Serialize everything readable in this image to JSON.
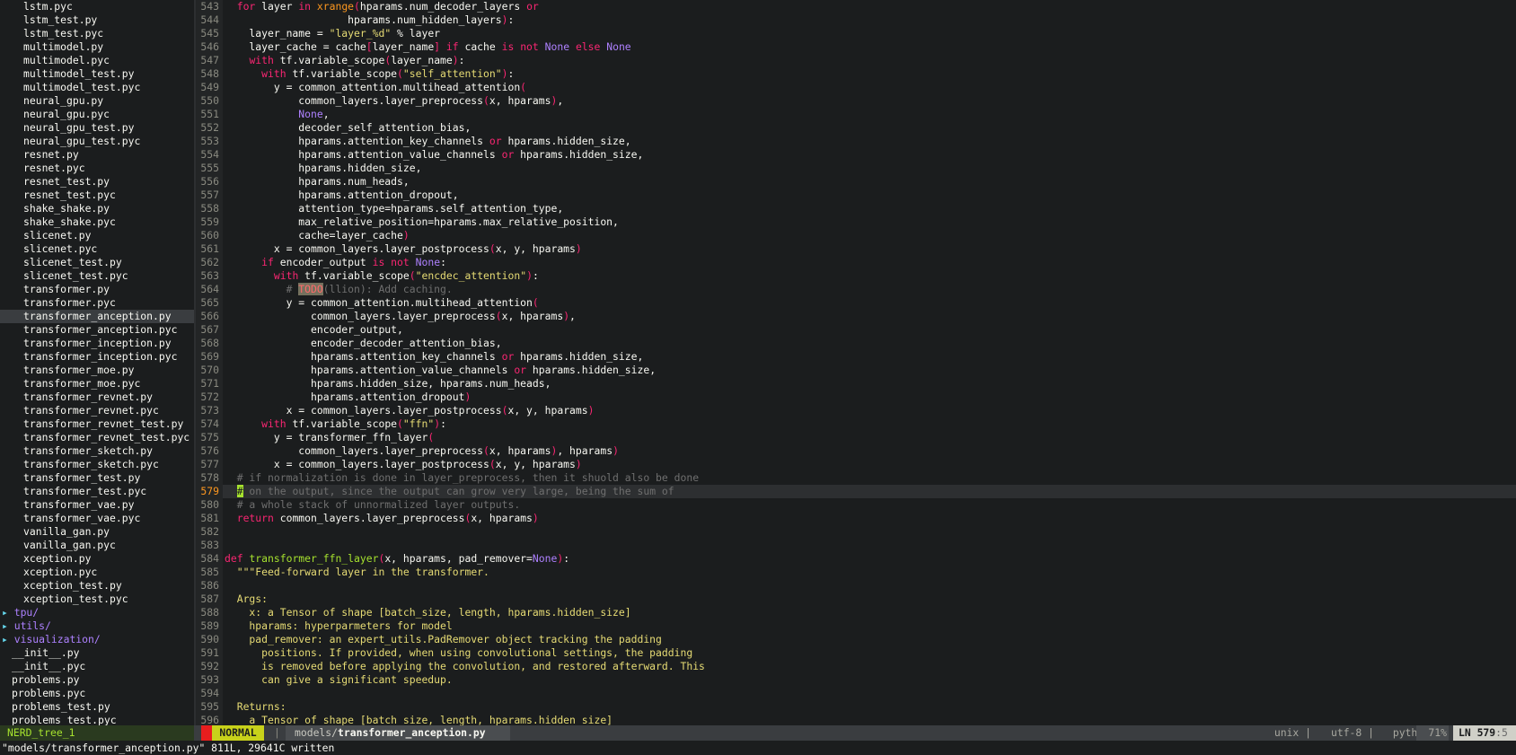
{
  "tree": {
    "files_indented": [
      "lstm.pyc",
      "lstm_test.py",
      "lstm_test.pyc",
      "multimodel.py",
      "multimodel.pyc",
      "multimodel_test.py",
      "multimodel_test.pyc",
      "neural_gpu.py",
      "neural_gpu.pyc",
      "neural_gpu_test.py",
      "neural_gpu_test.pyc",
      "resnet.py",
      "resnet.pyc",
      "resnet_test.py",
      "resnet_test.pyc",
      "shake_shake.py",
      "shake_shake.pyc",
      "slicenet.py",
      "slicenet.pyc",
      "slicenet_test.py",
      "slicenet_test.pyc",
      "transformer.py",
      "transformer.pyc",
      "transformer_anception.py",
      "transformer_anception.pyc",
      "transformer_inception.py",
      "transformer_inception.pyc",
      "transformer_moe.py",
      "transformer_moe.pyc",
      "transformer_revnet.py",
      "transformer_revnet.pyc",
      "transformer_revnet_test.py",
      "transformer_revnet_test.pyc",
      "transformer_sketch.py",
      "transformer_sketch.pyc",
      "transformer_test.py",
      "transformer_test.pyc",
      "transformer_vae.py",
      "transformer_vae.pyc",
      "vanilla_gan.py",
      "vanilla_gan.pyc",
      "xception.py",
      "xception.pyc",
      "xception_test.py",
      "xception_test.pyc"
    ],
    "selected": "transformer_anception.py",
    "dirs": [
      "tpu/",
      "utils/",
      "visualization/"
    ],
    "dir_arrow": "▸",
    "files_root": [
      "__init__.py",
      "__init__.pyc",
      "problems.py",
      "problems.pyc",
      "problems_test.py",
      "problems_test.pyc"
    ]
  },
  "editor": {
    "line_numbers": [
      "543",
      "544",
      "545",
      "546",
      "547",
      "548",
      "549",
      "550",
      "551",
      "552",
      "553",
      "554",
      "555",
      "556",
      "557",
      "558",
      "559",
      "560",
      "561",
      "562",
      "563",
      "564",
      "565",
      "566",
      "567",
      "568",
      "569",
      "570",
      "571",
      "572",
      "573",
      "574",
      "575",
      "576",
      "577",
      "578",
      "579",
      "580",
      "581",
      "582",
      "583",
      "584",
      "585",
      "586",
      "587",
      "588",
      "589",
      "590",
      "591",
      "592",
      "593",
      "594",
      "595",
      "596"
    ],
    "current_line": "579"
  },
  "status": {
    "tree_label": "NERD_tree_1",
    "mode": "NORMAL",
    "separator": "|",
    "path_dir": "models/",
    "path_file": "transformer_anception.py",
    "fileformat": "unix",
    "encoding": "utf-8",
    "filetype": "python",
    "percent": "71%",
    "position_ln": "LN 579",
    "position_col": ":5"
  },
  "cmdline": "\"models/transformer_anception.py\" 811L, 29641C written",
  "colors": {
    "background": "#1b1d1e",
    "keyword": "#f92672",
    "string": "#e6db74",
    "function": "#a6e22e",
    "comment": "#6f6f6f",
    "mode_bg": "#c8d21a"
  }
}
